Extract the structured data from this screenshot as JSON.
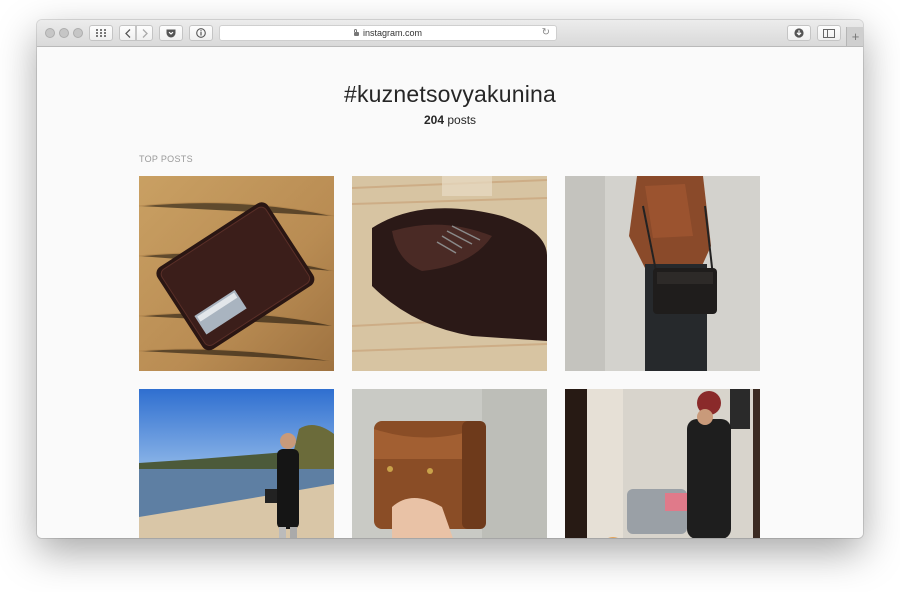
{
  "browser": {
    "url": "instagram.com",
    "new_tab_symbol": "+"
  },
  "page": {
    "hashtag": "#kuznetsovyakunina",
    "post_count": "204",
    "post_count_label": "posts",
    "section_label": "TOP POSTS"
  },
  "posts": [
    {
      "subject": "wallet-photo"
    },
    {
      "subject": "shoe-photo"
    },
    {
      "subject": "shoulder-bag-photo"
    },
    {
      "subject": "lake-portrait-photo"
    },
    {
      "subject": "clutch-photo"
    },
    {
      "subject": "mirror-selfie-photo"
    }
  ],
  "colors": {
    "window_bg": "#fafafa",
    "text_dark": "#262626",
    "text_muted": "#999999"
  },
  "icons": [
    "traffic-light-close-icon",
    "traffic-light-minimize-icon",
    "traffic-light-zoom-icon",
    "grid-icon",
    "back-arrow-icon",
    "forward-arrow-icon",
    "pocket-icon",
    "info-icon",
    "lock-icon",
    "reload-icon",
    "download-icon",
    "sidebar-icon",
    "new-tab-icon"
  ]
}
